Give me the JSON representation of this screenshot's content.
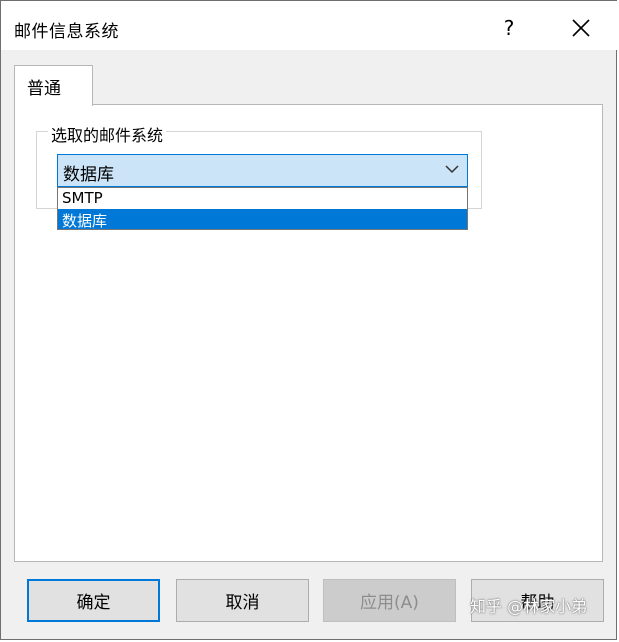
{
  "window": {
    "title": "邮件信息系统",
    "help_label": "?"
  },
  "tabs": [
    {
      "label": "普通"
    }
  ],
  "group": {
    "label": "选取的邮件系统",
    "selected_value": "数据库",
    "options": [
      "SMTP",
      "数据库"
    ]
  },
  "buttons": {
    "ok": "确定",
    "cancel": "取消",
    "apply": "应用(A)",
    "help": "帮助"
  },
  "watermark": "知乎 @林家小弟",
  "colors": {
    "accent": "#0078d7",
    "combo_bg": "#cce4f7",
    "dialog_bg": "#f0f0f0"
  }
}
